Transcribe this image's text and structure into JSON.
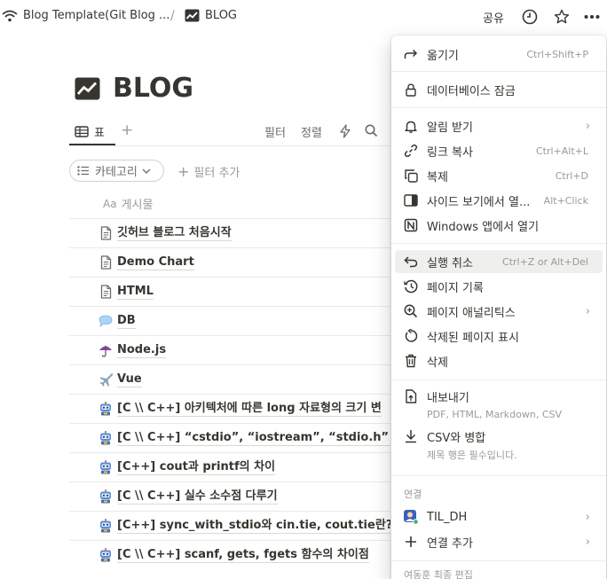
{
  "topbar": {
    "breadcrumb_parent": "Blog Template(Git Blog ...",
    "breadcrumb_separator": "/",
    "breadcrumb_current": "BLOG",
    "share_label": "공유"
  },
  "page": {
    "title": "BLOG"
  },
  "views": {
    "table_tab": "표",
    "add_view": "+",
    "filter": "필터",
    "sort": "정렬"
  },
  "filters": {
    "category_chip": "카테고리",
    "add_filter": "필터 추가"
  },
  "table": {
    "column_header": "게시물",
    "column_icon": "Aa",
    "rows": [
      {
        "icon": "page-icon",
        "title": "깃허브 블로그 처음시작"
      },
      {
        "icon": "page-icon",
        "title": "Demo Chart"
      },
      {
        "icon": "page-icon",
        "title": "HTML"
      },
      {
        "icon": "speech-bubble-icon",
        "title": "DB"
      },
      {
        "icon": "umbrella-icon",
        "title": "Node.js"
      },
      {
        "icon": "airplane-icon",
        "title": "Vue"
      },
      {
        "icon": "robot-icon",
        "title": "[C \\\\ C++] 아키텍처에 따른 long 자료형의 크기 변"
      },
      {
        "icon": "robot-icon",
        "title": "[C \\\\ C++] “cstdio”, “iostream”, “stdio.h” 설명 및 차"
      },
      {
        "icon": "robot-icon",
        "title": "[C++] cout과 printf의 차이"
      },
      {
        "icon": "robot-icon",
        "title": "[C \\\\ C++] 실수 소수점 다루기"
      },
      {
        "icon": "robot-icon",
        "title": "[C++]  sync_with_stdio와 cin.tie, cout.tie란?"
      },
      {
        "icon": "robot-icon",
        "title": "[C \\\\ C++] scanf, gets, fgets 함수의 차이점"
      }
    ]
  },
  "menu": {
    "move": {
      "label": "옮기기",
      "shortcut": "Ctrl+Shift+P"
    },
    "lock": {
      "label": "데이터베이스 잠금"
    },
    "notify": {
      "label": "알림 받기"
    },
    "copy_link": {
      "label": "링크 복사",
      "shortcut": "Ctrl+Alt+L"
    },
    "duplicate": {
      "label": "복제",
      "shortcut": "Ctrl+D"
    },
    "side_peek": {
      "label": "사이드 보기에서 열...",
      "shortcut": "Alt+Click"
    },
    "open_app": {
      "label": "Windows 앱에서 열기"
    },
    "undo": {
      "label": "실행 취소",
      "shortcut": "Ctrl+Z or Alt+Del"
    },
    "history": {
      "label": "페이지 기록"
    },
    "analytics": {
      "label": "페이지 애널리틱스"
    },
    "deleted": {
      "label": "삭제된 페이지 표시"
    },
    "delete": {
      "label": "삭제"
    },
    "export": {
      "label": "내보내기",
      "sub": "PDF, HTML, Markdown, CSV"
    },
    "merge": {
      "label": "CSV와 병합",
      "sub": "제목 행은 필수입니다."
    },
    "connections_header": "연결",
    "connection_item": {
      "label": "TIL_DH"
    },
    "add_connection": {
      "label": "연결 추가"
    },
    "footer": "여동훈 최종 편집"
  },
  "colors": {
    "text": "#37352f",
    "muted": "#9b9a97",
    "hover": "#efefee"
  }
}
